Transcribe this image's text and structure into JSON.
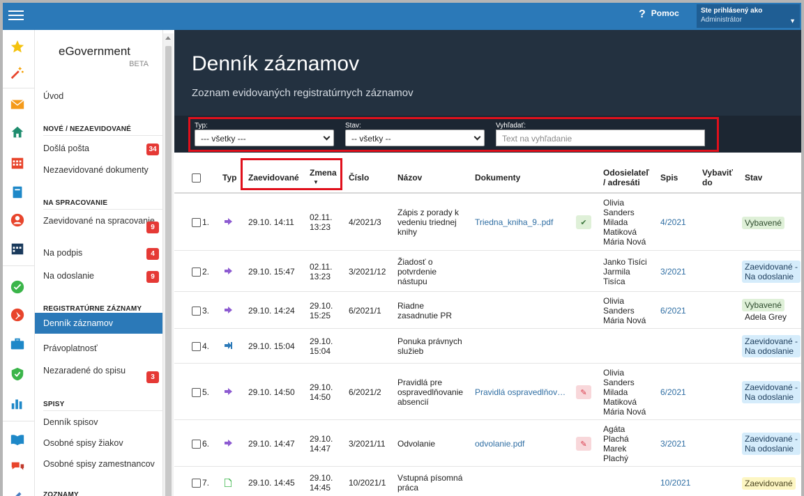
{
  "topbar": {
    "help_label": "Pomoc",
    "user_line1": "Ste prihlásený ako",
    "user_line2": "Administrátor"
  },
  "sidebar": {
    "brand": "eGovernment",
    "beta": "BETA",
    "intro": "Úvod",
    "sections": [
      {
        "title": "NOVÉ / NEZAEVIDOVANÉ",
        "items": [
          {
            "label": "Došlá pošta",
            "badge": "34"
          },
          {
            "label": "Nezaevidované dokumenty",
            "badge": ""
          }
        ]
      },
      {
        "title": "NA SPRACOVANIE",
        "items": [
          {
            "label": "Zaevidované na spracovanie",
            "badge": "9"
          },
          {
            "label": "Na podpis",
            "badge": "4"
          },
          {
            "label": "Na odoslanie",
            "badge": "9"
          }
        ]
      },
      {
        "title": "REGISTRATÚRNE ZÁZNAMY",
        "items": [
          {
            "label": "Denník záznamov",
            "badge": ""
          },
          {
            "label": "Právoplatnosť",
            "badge": ""
          },
          {
            "label": "Nezaradené do spisu",
            "badge": "3"
          }
        ]
      },
      {
        "title": "SPISY",
        "items": [
          {
            "label": "Denník spisov",
            "badge": ""
          },
          {
            "label": "Osobné spisy žiakov",
            "badge": ""
          },
          {
            "label": "Osobné spisy zamestnancov",
            "badge": ""
          }
        ]
      },
      {
        "title": "ZOZNAMY",
        "items": []
      }
    ],
    "icons": [
      "star-icon",
      "magic-wand-icon",
      "envelope-icon",
      "home-icon",
      "calendar-grid-icon",
      "notebook-icon",
      "person-icon",
      "calendar-icon",
      "check-circle-icon",
      "pushpin-icon",
      "briefcase-icon",
      "shield-icon",
      "bar-chart-icon",
      "book-icon",
      "chat-icon",
      "pen-icon"
    ]
  },
  "header": {
    "title": "Denník záznamov",
    "subtitle": "Zoznam evidovaných registratúrnych záznamov"
  },
  "filters": {
    "type_label": "Typ:",
    "type_value": "--- všetky ---",
    "status_label": "Stav:",
    "status_value": "-- všetky --",
    "search_label": "Vyhľadať:",
    "search_placeholder": "Text na vyhľadanie"
  },
  "table": {
    "headers": {
      "type": "Typ",
      "registered": "Zaevidované",
      "changed": "Zmena",
      "number": "Číslo",
      "name": "Názov",
      "documents": "Dokumenty",
      "senders1": "Odosielateľ",
      "senders2": "/ adresáti",
      "file": "Spis",
      "resolve1": "Vybaviť",
      "resolve2": "do",
      "status": "Stav"
    },
    "rows": [
      {
        "idx": "1.",
        "type": "outgoing-arrow-icon",
        "registered": "29.10. 14:11",
        "changed1": "02.11.",
        "changed2": "13:23",
        "number": "4/2021/3",
        "name": [
          "Zápis z porady k",
          "vedeniu triednej",
          "knihy"
        ],
        "doc": "Triedna_kniha_9..pdf",
        "doc_btn": "check-badge-icon",
        "senders": [
          "Olivia",
          "Sanders",
          "Milada",
          "Matiková",
          "Mária Nová"
        ],
        "file": "4/2021",
        "status": [
          "Vybavené"
        ],
        "status_color": "green",
        "extra": ""
      },
      {
        "idx": "2.",
        "type": "outgoing-arrow-icon",
        "registered": "29.10. 15:47",
        "changed1": "02.11.",
        "changed2": "13:23",
        "number": "3/2021/12",
        "name": [
          "Žiadosť o",
          "potvrdenie",
          "nástupu"
        ],
        "doc": "",
        "doc_btn": "",
        "senders": [
          "Janko Tisíci",
          "Jarmila",
          "Tisíca"
        ],
        "file": "3/2021",
        "status": [
          "Zaevidované -",
          "Na odoslanie"
        ],
        "status_color": "blue",
        "extra": ""
      },
      {
        "idx": "3.",
        "type": "outgoing-arrow-icon",
        "registered": "29.10. 14:24",
        "changed1": "29.10.",
        "changed2": "15:25",
        "number": "6/2021/1",
        "name": [
          "Riadne",
          "zasadnutie PR"
        ],
        "doc": "",
        "doc_btn": "",
        "senders": [
          "Olivia",
          "Sanders",
          "Mária Nová"
        ],
        "file": "6/2021",
        "status": [
          "Vybavené"
        ],
        "status_color": "green",
        "extra": "Adela Grey"
      },
      {
        "idx": "4.",
        "type": "incoming-arrow-icon",
        "registered": "29.10. 15:04",
        "changed1": "29.10.",
        "changed2": "15:04",
        "number": "",
        "name": [
          "Ponuka právnych",
          "služieb"
        ],
        "doc": "",
        "doc_btn": "",
        "senders": [],
        "file": "",
        "status": [
          "Zaevidované -",
          "Na odoslanie"
        ],
        "status_color": "blue",
        "extra": ""
      },
      {
        "idx": "5.",
        "type": "outgoing-arrow-icon",
        "registered": "29.10. 14:50",
        "changed1": "29.10.",
        "changed2": "14:50",
        "number": "6/2021/2",
        "name": [
          "Pravidlá pre",
          "ospravedlňovanie",
          "absencií"
        ],
        "doc": "Pravidlá ospravedlňov…",
        "doc_btn": "pencil-icon",
        "senders": [
          "Olivia",
          "Sanders",
          "Milada",
          "Matiková",
          "Mária Nová"
        ],
        "file": "6/2021",
        "status": [
          "Zaevidované -",
          "Na odoslanie"
        ],
        "status_color": "blue",
        "extra": ""
      },
      {
        "idx": "6.",
        "type": "outgoing-arrow-icon",
        "registered": "29.10. 14:47",
        "changed1": "29.10.",
        "changed2": "14:47",
        "number": "3/2021/11",
        "name": [
          "Odvolanie"
        ],
        "doc": "odvolanie.pdf",
        "doc_btn": "pencil-icon",
        "senders": [
          "Agáta",
          "Plachá",
          "Marek",
          "Plachý"
        ],
        "file": "3/2021",
        "status": [
          "Zaevidované -",
          "Na odoslanie"
        ],
        "status_color": "blue",
        "extra": ""
      },
      {
        "idx": "7.",
        "type": "document-icon",
        "registered": "29.10. 14:45",
        "changed1": "29.10.",
        "changed2": "14:45",
        "number": "10/2021/1",
        "name": [
          "Vstupná písomná",
          "práca"
        ],
        "doc": "",
        "doc_btn": "",
        "senders": [],
        "file": "10/2021",
        "status": [
          "Zaevidované"
        ],
        "status_color": "yellow",
        "extra": ""
      }
    ]
  },
  "colors": {
    "topbar": "#2b79b8",
    "header": "#233140",
    "highlight": "#e0101c",
    "badge": "#e53935",
    "link": "#2f6ea3"
  }
}
